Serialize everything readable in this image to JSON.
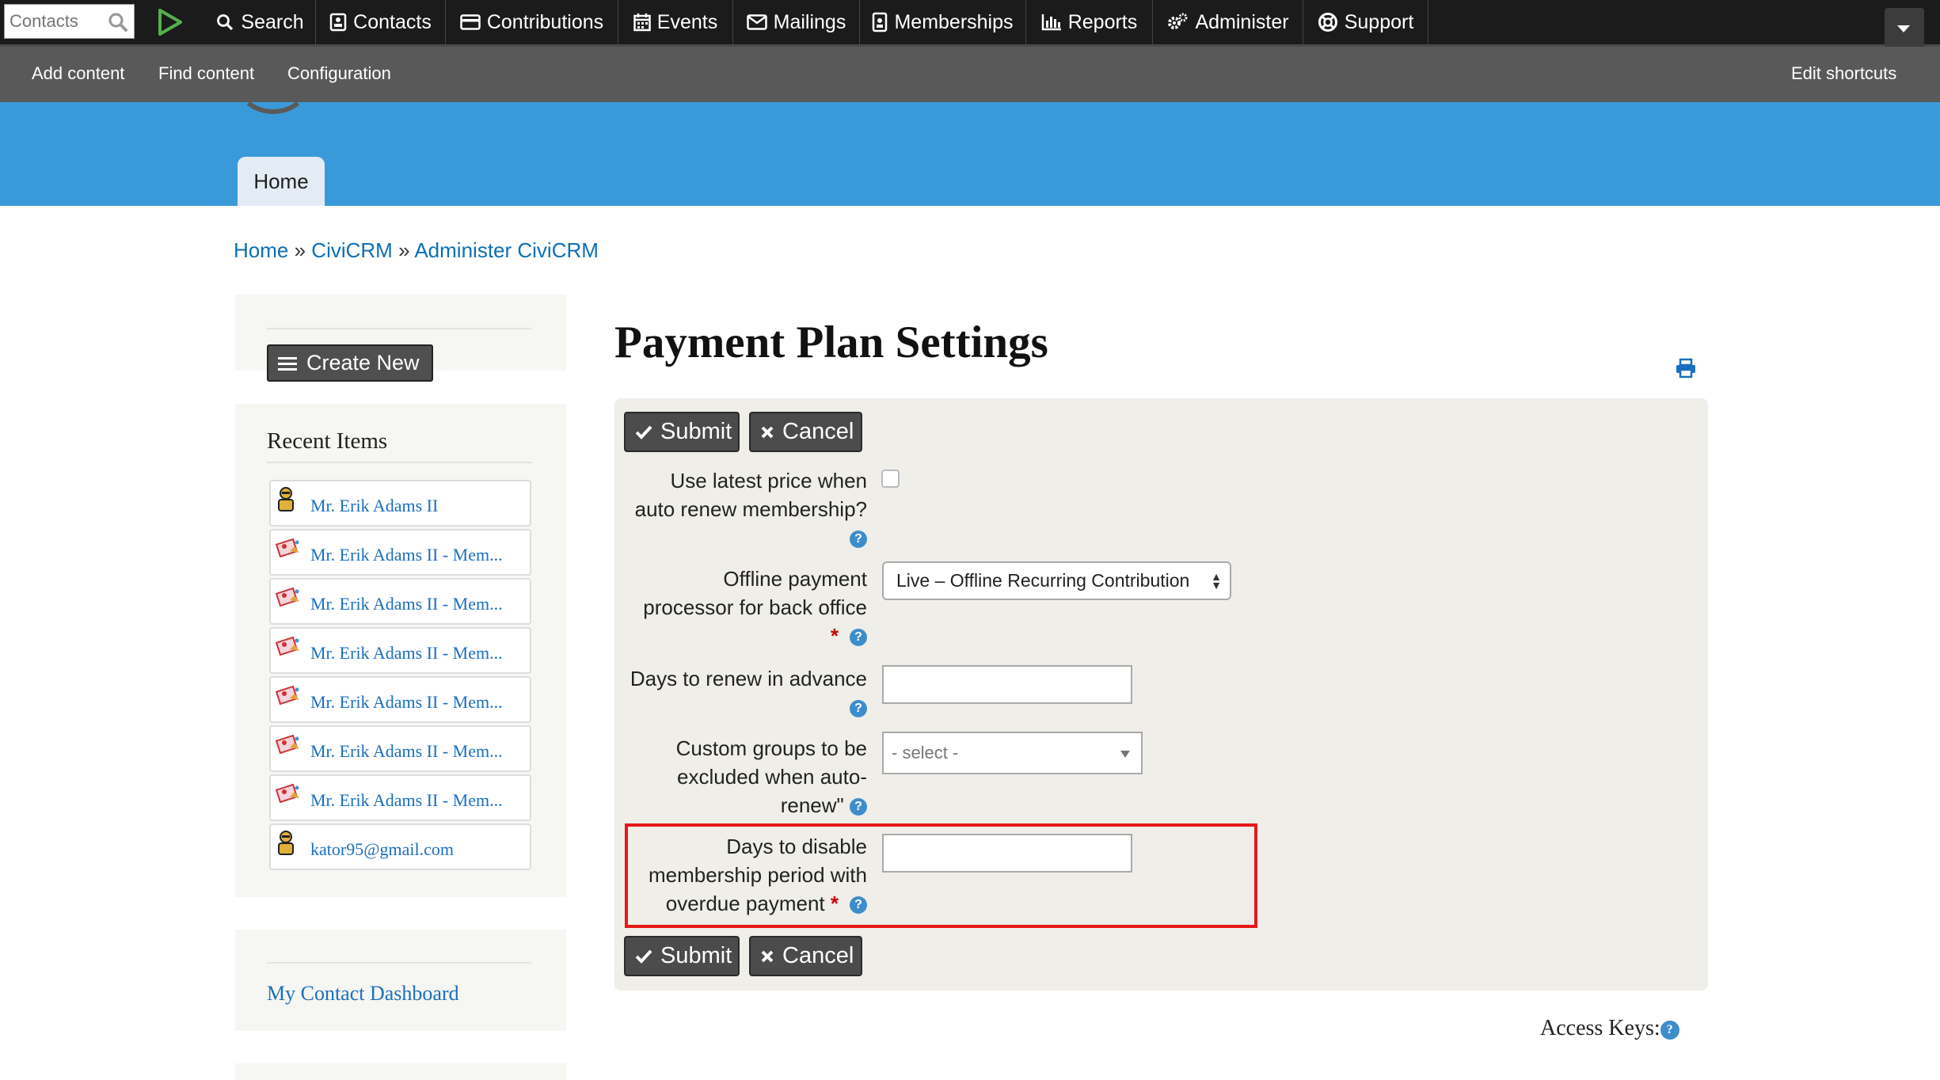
{
  "civi_menu": {
    "quicksearch_placeholder": "Contacts",
    "items": [
      {
        "label": "Search",
        "icon": "search-icon"
      },
      {
        "label": "Contacts",
        "icon": "contact-card-icon"
      },
      {
        "label": "Contributions",
        "icon": "credit-card-icon"
      },
      {
        "label": "Events",
        "icon": "calendar-icon"
      },
      {
        "label": "Mailings",
        "icon": "envelope-icon"
      },
      {
        "label": "Memberships",
        "icon": "id-badge-icon"
      },
      {
        "label": "Reports",
        "icon": "bar-chart-icon"
      },
      {
        "label": "Administer",
        "icon": "gears-icon"
      },
      {
        "label": "Support",
        "icon": "life-ring-icon"
      }
    ]
  },
  "toolbar": {
    "add_content": "Add content",
    "find_content": "Find content",
    "configuration": "Configuration",
    "edit_shortcuts": "Edit shortcuts"
  },
  "header": {
    "home_tab": "Home"
  },
  "breadcrumb": {
    "items": [
      "Home",
      "CiviCRM",
      "Administer CiviCRM"
    ],
    "separator": "»"
  },
  "sidebar": {
    "create_new": "Create New",
    "recent_title": "Recent Items",
    "recent_items": [
      {
        "label": "Mr. Erik Adams II",
        "icon": "contact-person-icon"
      },
      {
        "label": "Mr. Erik Adams II - Mem...",
        "icon": "membership-icon"
      },
      {
        "label": "Mr. Erik Adams II - Mem...",
        "icon": "membership-icon"
      },
      {
        "label": "Mr. Erik Adams II - Mem...",
        "icon": "membership-icon"
      },
      {
        "label": "Mr. Erik Adams II - Mem...",
        "icon": "membership-icon"
      },
      {
        "label": "Mr. Erik Adams II - Mem...",
        "icon": "membership-icon"
      },
      {
        "label": "Mr. Erik Adams II - Mem...",
        "icon": "membership-icon"
      },
      {
        "label": "kator95@gmail.com",
        "icon": "contact-person-icon"
      }
    ],
    "dashboard_link": "My Contact Dashboard"
  },
  "main": {
    "title": "Payment Plan Settings",
    "submit": "Submit",
    "cancel": "Cancel",
    "fields": {
      "latest_price": {
        "label_line1": "Use latest price when",
        "label_line2": "auto renew membership?",
        "checked": false
      },
      "processor": {
        "label_line1": "Offline payment",
        "label_line2": "processor for back office",
        "value": "Live – Offline Recurring Contribution"
      },
      "days_renew": {
        "label": "Days to renew in advance",
        "value": ""
      },
      "custom_groups": {
        "label_line1": "Custom groups to be",
        "label_line2": "excluded when auto-",
        "label_line3": "renew\"",
        "placeholder": "- select -"
      },
      "days_disable": {
        "label_line1": "Days to disable",
        "label_line2": "membership period with",
        "label_line3": "overdue payment",
        "value": ""
      }
    },
    "required_mark": "*",
    "help_mark": "?",
    "access_keys": "Access Keys:"
  },
  "colors": {
    "civi_bar": "#1b1b1b",
    "drupal_toolbar": "#595959",
    "header_blue": "#3a9ad9",
    "link_blue": "#1b6fbf",
    "help_blue": "#3e8dcb",
    "highlight_red": "#e61919",
    "required_red": "#cc0000"
  }
}
